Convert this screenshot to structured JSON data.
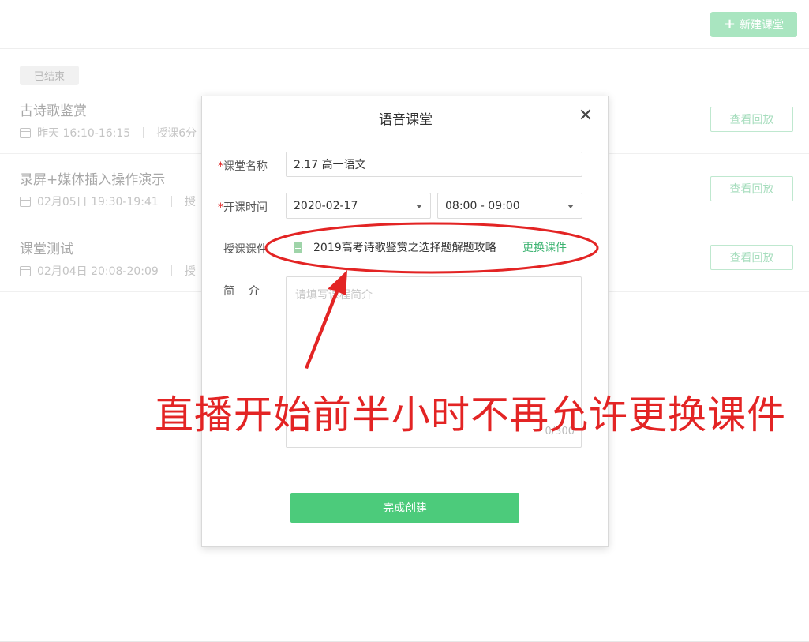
{
  "header": {
    "new_button_icon": "+",
    "new_button_label": "新建课堂"
  },
  "list": {
    "status_tag": "已结束",
    "replay_label": "查看回放",
    "courses": [
      {
        "title": "古诗歌鉴赏",
        "time": "昨天 16:10-16:15",
        "extra": "授课6分"
      },
      {
        "title": "录屏+媒体插入操作演示",
        "time": "02月05日 19:30-19:41",
        "extra": "授"
      },
      {
        "title": "课堂测试",
        "time": "02月04日 20:08-20:09",
        "extra": "授"
      }
    ]
  },
  "dialog": {
    "title": "语音课堂",
    "close_icon": "✕",
    "required_mark": "*",
    "name_label": "课堂名称",
    "name_value": "2.17 高一语文",
    "time_label": "开课时间",
    "date_value": "2020-02-17",
    "time_value": "08:00 - 09:00",
    "courseware_label": "授课课件",
    "courseware_value": "2019高考诗歌鉴赏之选择题解题攻略",
    "change_label": "更换课件",
    "intro_label": "简    介",
    "intro_placeholder": "请填写课程简介",
    "intro_count": "0/300",
    "submit_label": "完成创建"
  },
  "annotation": {
    "text": "直播开始前半小时不再允许更换课件",
    "color": "#e32424"
  },
  "colors": {
    "primary_green": "#4ccb7b",
    "annotation_red": "#e32424"
  }
}
